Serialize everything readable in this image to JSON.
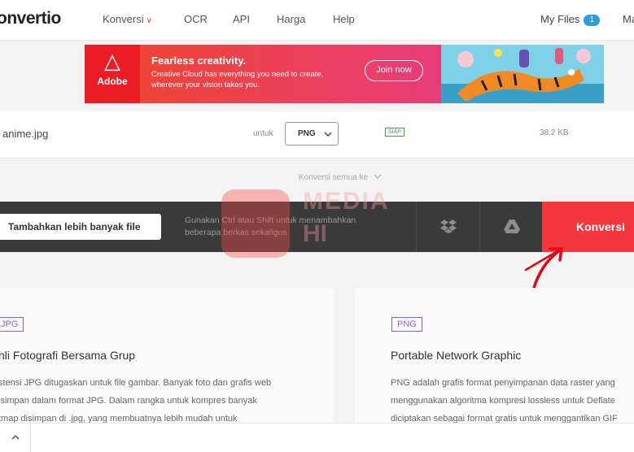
{
  "header": {
    "logo": "onvertio",
    "nav": [
      {
        "label": "Konversi",
        "has_dropdown": true
      },
      {
        "label": "OCR"
      },
      {
        "label": "API"
      },
      {
        "label": "Harga"
      },
      {
        "label": "Help"
      }
    ],
    "my_files_label": "My Files",
    "my_files_count": "1",
    "right_cut_label": "Ma"
  },
  "ad": {
    "brand": "Adobe",
    "title": "Fearless creativity.",
    "text": "Creative Cloud has everything you need to create, wherever your vision takes you.",
    "cta": "Join now"
  },
  "file": {
    "name": "anime.jpg",
    "untuk_label": "untuk",
    "format": "PNG",
    "status": "SIAP",
    "size": "38.2 KB"
  },
  "convert_all_label": "Konversi semua ke",
  "action_bar": {
    "add_label": "Tambahkan lebih banyak file",
    "hint": "Gunakan Ctrl atau Shift untuk menambahkan beberapa berkas sekaligus",
    "convert_label": "Konversi"
  },
  "watermark": {
    "line1": "MEDIA",
    "line2": "HI"
  },
  "cards": [
    {
      "tag": "JPG",
      "title": "hli Fotografi Bersama Grup",
      "desc": [
        "stensi JPG ditugaskan untuk file gambar. Banyak foto dan grafis web",
        "isimpan dalam format JPG. Dalam rangka untuk kompres banyak",
        "tmap disimpan di .jpg, yang membuatnya lebih mudah untuk"
      ]
    },
    {
      "tag": "PNG",
      "title": "Portable Network Graphic",
      "desc": [
        "PNG adalah grafis format penyimpanan data raster yang",
        "menggunakan algoritma kompresi lossless untuk Deflate",
        "diciptakan sebagai format gratis untuk menggantikan GIF"
      ]
    }
  ],
  "colors": {
    "accent_red": "#f4363d",
    "badge_blue": "#2d9cdb",
    "ready_green": "#43a047",
    "tag_purple": "#8e5ed6"
  },
  "icons": [
    "chevron-down-icon",
    "dropbox-icon",
    "google-drive-icon",
    "chevron-up-icon",
    "arrow-annotation"
  ]
}
